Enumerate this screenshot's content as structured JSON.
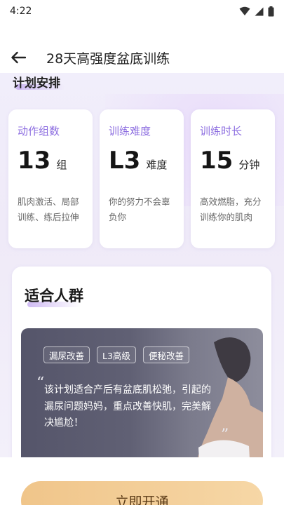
{
  "status_bar": {
    "time": "4:22"
  },
  "header": {
    "title": "28天高强度盆底训练"
  },
  "plan": {
    "section_title": "计划安排",
    "cards": [
      {
        "label": "动作组数",
        "value": "13",
        "unit": "组",
        "desc": "肌肉激活、局部训练、练后拉伸"
      },
      {
        "label": "训练难度",
        "value": "L3",
        "unit": "难度",
        "desc": "你的努力不会辜负你"
      },
      {
        "label": "训练时长",
        "value": "15",
        "unit": "分钟",
        "desc": "高效燃脂，充分训练你的肌肉"
      }
    ]
  },
  "audience": {
    "section_title": "适合人群",
    "tags": [
      "漏尿改善",
      "L3高级",
      "便秘改善"
    ],
    "quote_open": "“",
    "quote_close": "”",
    "description": "该计划适合产后有盆底肌松弛，引起的漏尿问题妈妈，重点改善快肌，完美解决尴尬！"
  },
  "cta": {
    "label": "立即开通"
  },
  "colors": {
    "accent": "#8c6de0",
    "cta": "#f0c58a"
  },
  "icons": [
    "back-arrow-icon",
    "wifi-icon",
    "signal-icon",
    "battery-icon"
  ]
}
